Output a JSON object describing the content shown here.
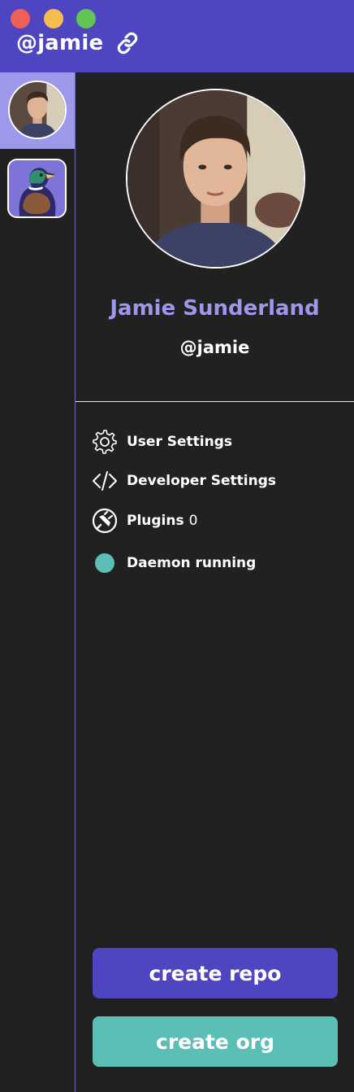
{
  "window": {
    "title": "@jamie",
    "controls": [
      "close",
      "minimize",
      "zoom"
    ]
  },
  "colors": {
    "titlebar": "#4e45c0",
    "accent": "#9d98ea",
    "teal": "#5bbfb5",
    "background": "#212121"
  },
  "sidebar": {
    "items": [
      {
        "type": "user",
        "icon": "user-avatar",
        "active": true
      },
      {
        "type": "org",
        "icon": "duck-org-avatar",
        "active": false
      }
    ]
  },
  "profile": {
    "name": "Jamie Sunderland",
    "handle": "@jamie",
    "avatar_icon": "user-avatar"
  },
  "menu": {
    "user_settings": {
      "label": "User Settings",
      "icon": "gear-icon"
    },
    "developer_settings": {
      "label": "Developer Settings",
      "icon": "code-icon"
    },
    "plugins": {
      "label": "Plugins",
      "count": "0",
      "icon": "plug-icon"
    },
    "daemon": {
      "label": "Daemon running",
      "icon": "status-dot"
    }
  },
  "buttons": {
    "create_repo": "create repo",
    "create_org": "create org"
  }
}
